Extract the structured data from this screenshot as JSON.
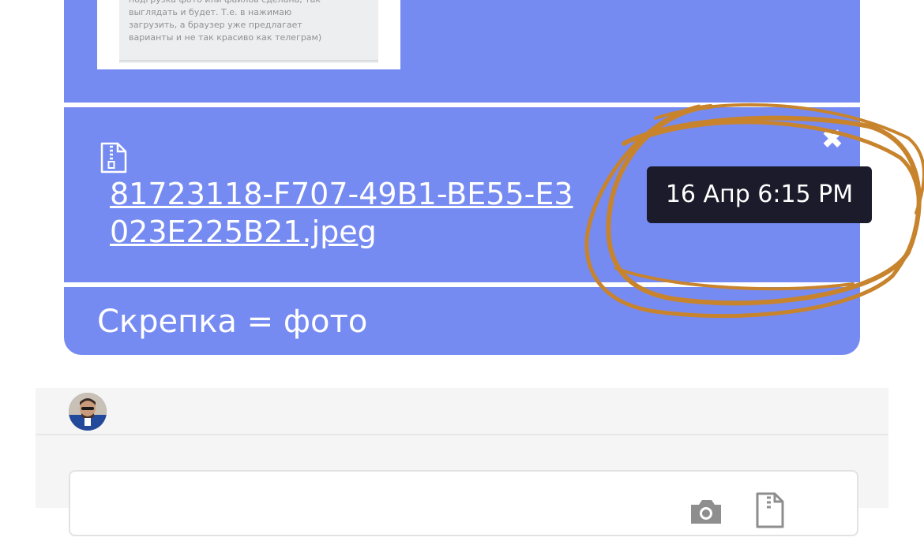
{
  "preview": {
    "lines": [
      "подгрузка фото или файлов сделана, так",
      "выглядать и будет. Т.е. в нажимаю",
      "загрузить, а браузер уже предлагает",
      "варианты и не так красиво как телеграм)"
    ]
  },
  "attachment": {
    "file_icon": "zip-file-icon",
    "file_name": "81723118-F707-49B1-BE55-E3023E225B21.jpeg",
    "close_icon": "close-icon",
    "timestamp": "16 Апр 6:15 PM"
  },
  "message": {
    "caption": "Скрепка = фото"
  },
  "colors": {
    "bubble": "#768bf2",
    "tooltip_bg": "#1b1b2b",
    "annotation": "#c8832d",
    "panel_bg": "#f5f5f5"
  },
  "composer": {
    "avatar_icon": "avatar",
    "input_placeholder": "",
    "camera_icon": "camera-icon",
    "attach_icon": "attach-file-icon"
  }
}
